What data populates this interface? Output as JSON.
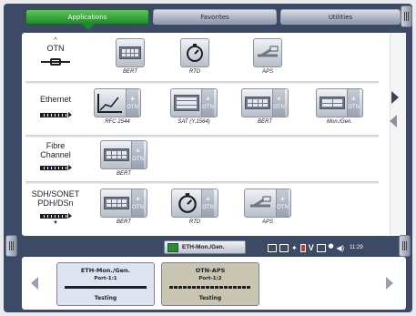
{
  "tabs": [
    {
      "label": "Applications",
      "active": true
    },
    {
      "label": "Favorites",
      "active": false
    },
    {
      "label": "Utilities",
      "active": false
    }
  ],
  "categories": [
    {
      "label_lines": [
        "OTN"
      ],
      "apps": [
        {
          "name": "BERT",
          "icon": "module-icon"
        },
        {
          "name": "RTD",
          "icon": "stopwatch-icon"
        },
        {
          "name": "APS",
          "icon": "aps-icon"
        }
      ]
    },
    {
      "label_lines": [
        "Ethernet"
      ],
      "apps": [
        {
          "name": "RFC 2544",
          "icon": "graph-icon"
        },
        {
          "name": "SAT (Y.1564)",
          "icon": "sat-icon"
        },
        {
          "name": "BERT",
          "icon": "module-icon"
        },
        {
          "name": "Mon./Gen.",
          "icon": "mongen-icon"
        }
      ]
    },
    {
      "label_lines": [
        "Fibre",
        "Channel"
      ],
      "apps": [
        {
          "name": "BERT",
          "icon": "module-icon"
        }
      ]
    },
    {
      "label_lines": [
        "SDH/SONET",
        "PDH/DSn"
      ],
      "apps": [
        {
          "name": "BERT",
          "icon": "module-icon"
        },
        {
          "name": "RTD",
          "icon": "stopwatch-icon"
        },
        {
          "name": "APS",
          "icon": "aps-icon"
        }
      ]
    }
  ],
  "tile_plus_text": "OTN",
  "active_test": "ETH-Mon./Gen.",
  "clock": "11:29",
  "tests": [
    {
      "name": "ETH-Mon./Gen.",
      "port": "Port-1:1",
      "status": "Testing",
      "color": "#dfe3ef"
    },
    {
      "name": "OTN-APS",
      "port": "Port-1:2",
      "status": "Testing",
      "color": "#c9c5b0"
    }
  ],
  "colors": {
    "accent": "#1f8a2a",
    "screen": "#3d4a66"
  }
}
